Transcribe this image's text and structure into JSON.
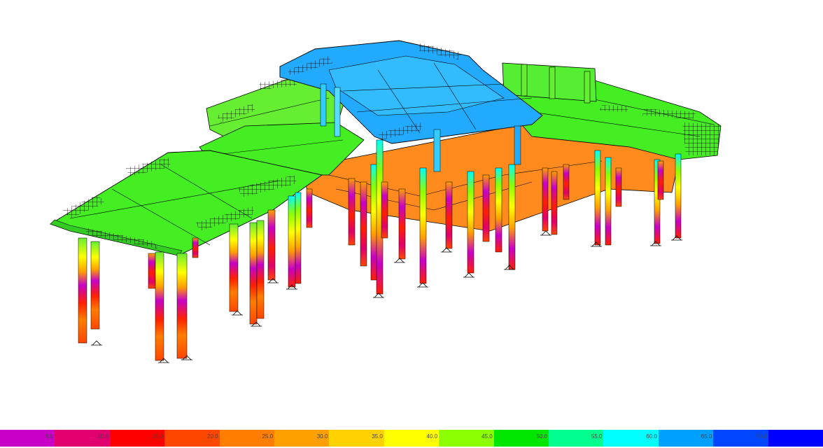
{
  "legend": {
    "stops": [
      {
        "color": "#c800c8",
        "label": "5.0"
      },
      {
        "color": "#e0006e",
        "label": "10.0"
      },
      {
        "color": "#ff0000",
        "label": "15.0"
      },
      {
        "color": "#ff4600",
        "label": "20.0"
      },
      {
        "color": "#ff7d00",
        "label": "25.0"
      },
      {
        "color": "#ffa000",
        "label": "30.0"
      },
      {
        "color": "#ffd200",
        "label": "35.0"
      },
      {
        "color": "#ffff00",
        "label": "40.0"
      },
      {
        "color": "#8cff00",
        "label": "45.0"
      },
      {
        "color": "#00e600",
        "label": "50.0"
      },
      {
        "color": "#00ff8c",
        "label": "55.0"
      },
      {
        "color": "#00ffff",
        "label": "60.0"
      },
      {
        "color": "#00a0ff",
        "label": "65.0"
      },
      {
        "color": "#0046ff",
        "label": "70.0"
      },
      {
        "color": "#0000ff",
        "label": ""
      }
    ]
  },
  "colors": {
    "green_slab": "#44ee22",
    "light_green_slab": "#66ee33",
    "blue_roof": "#22aaff",
    "cyan_roof": "#33ccff",
    "orange_slab": "#ff8a1e",
    "edge": "#000000"
  }
}
